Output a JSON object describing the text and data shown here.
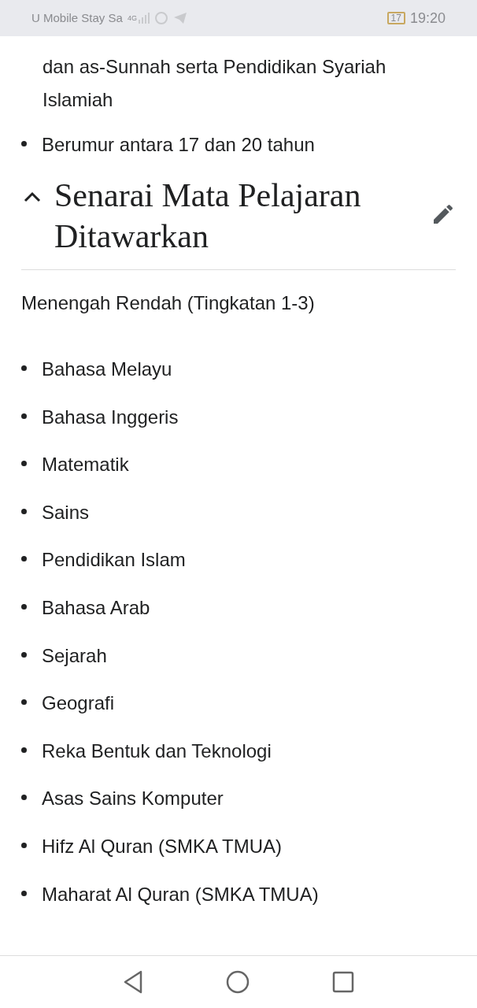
{
  "status_bar": {
    "carrier": "U Mobile Stay Sa",
    "network": "4G",
    "battery": "17",
    "time": "19:20"
  },
  "article": {
    "continued_item": "dan as-Sunnah serta Pendidikan Syariah Islamiah",
    "list_items": [
      "Berumur antara 17 dan 20 tahun"
    ],
    "section": {
      "title": "Senarai Mata Pelajaran Ditawarkan",
      "expanded": true,
      "subheading": "Menengah Rendah (Tingkatan 1-3)",
      "subjects": [
        "Bahasa Melayu",
        "Bahasa Inggeris",
        "Matematik",
        "Sains",
        "Pendidikan Islam",
        "Bahasa Arab",
        "Sejarah",
        "Geografi",
        "Reka Bentuk dan Teknologi",
        "Asas Sains Komputer",
        "Hifz Al Quran (SMKA TMUA)",
        "Maharat Al Quran (SMKA TMUA)"
      ]
    }
  }
}
